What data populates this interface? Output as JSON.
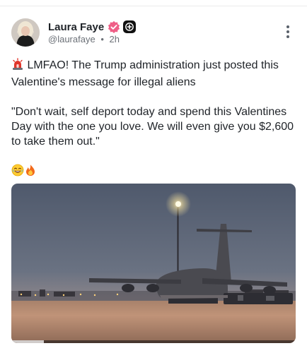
{
  "post": {
    "author": {
      "name": "Laura Faye",
      "handle": "@laurafaye",
      "time": "2h"
    },
    "separator": "•",
    "line1": "LMFAO! The Trump administration just posted this Valentine's message for illegal aliens",
    "quote": "\"Don't wait, self deport today and spend this Valentines Day with the one you love. We will even give you $2,600 to take them out.\"",
    "icons": {
      "siren": "police-siren-icon",
      "laugh": "tears-of-joy-emoji",
      "fire": "fire-emoji",
      "verified": "verified-badge-icon",
      "plus": "plus-badge-icon",
      "menu": "more-vertical-icon"
    },
    "colors": {
      "verified": "#ef5f87",
      "siren": "#e0362b",
      "sky_top": "#4f596c",
      "ground": "#c09378"
    }
  }
}
